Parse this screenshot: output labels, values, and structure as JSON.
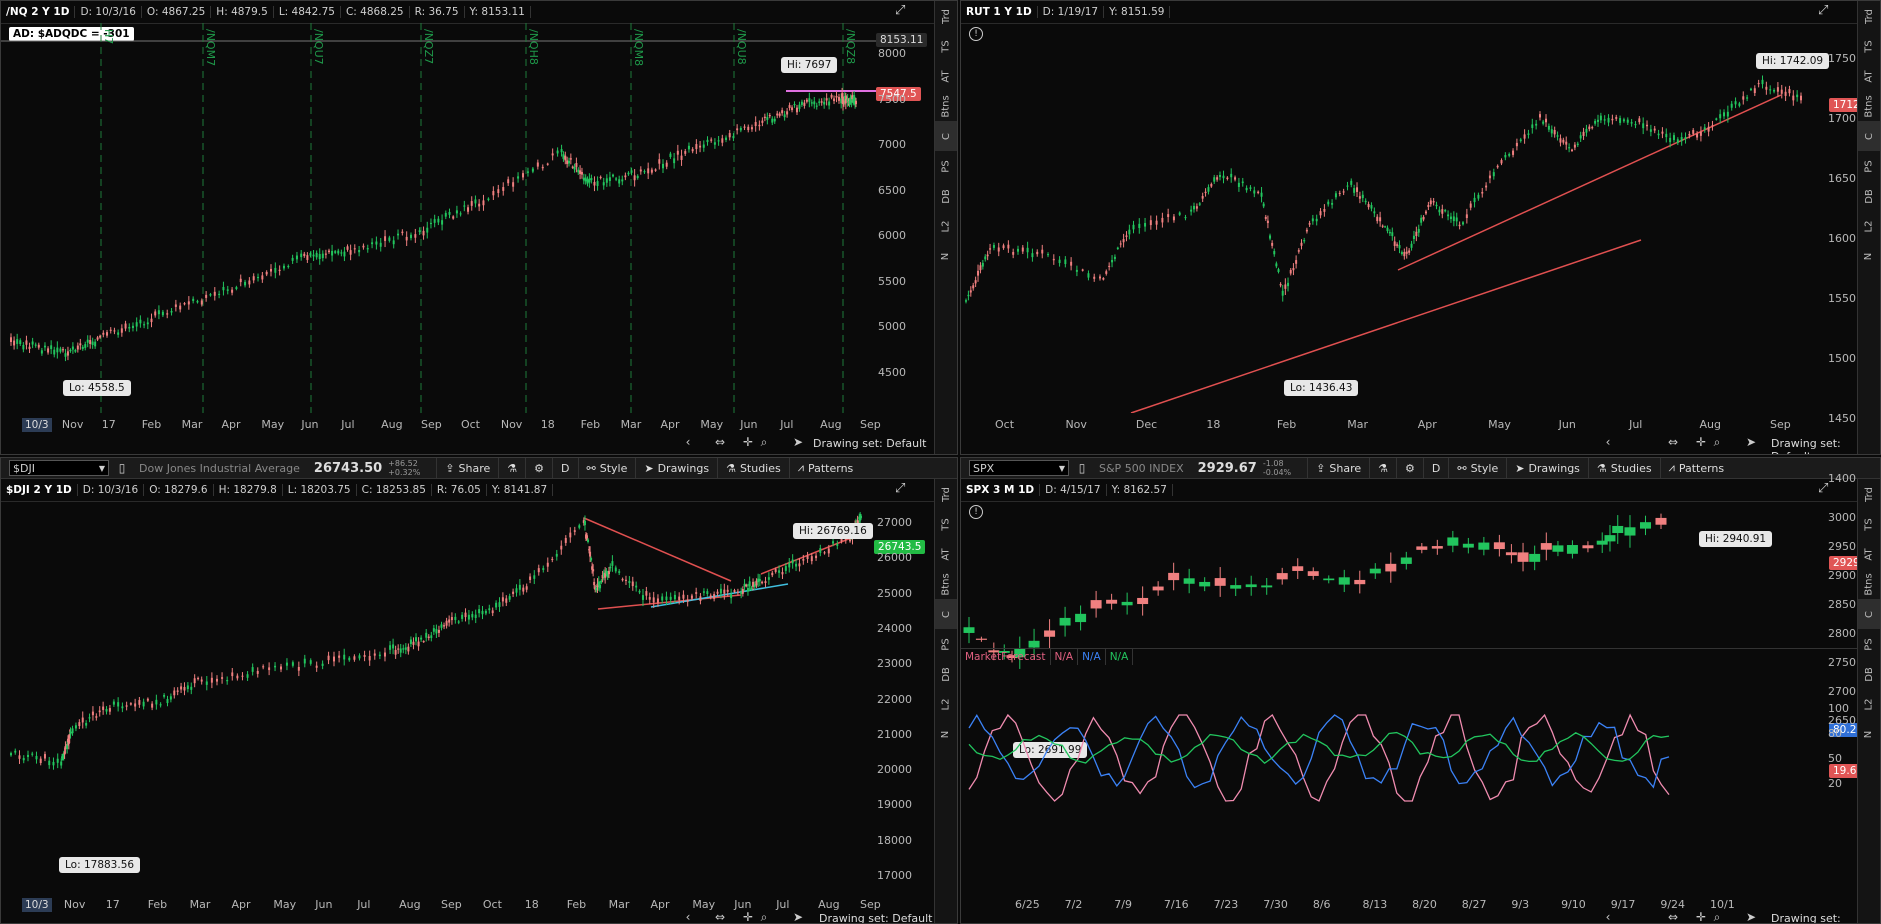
{
  "colors": {
    "up": "#22c55e",
    "down": "#f08080",
    "trend": "#e05050",
    "pink": "#e070e0",
    "cyan": "#40c0e0",
    "accent_green": "#22bb44",
    "accent_red": "#e05555",
    "accent_blue": "#2f6fd6"
  },
  "drawing_set": "Drawing set: Default",
  "side_tabs": [
    "Trd",
    "TS",
    "AT",
    "Btns",
    "C",
    "PS",
    "DB",
    "L2",
    "N"
  ],
  "p1": {
    "title": "/NQ 2 Y 1D",
    "d": "D: 10/3/16",
    "o": "O: 4867.25",
    "h": "H: 4879.5",
    "l": "L: 4842.75",
    "c": "C: 4868.25",
    "r": "R: 36.75",
    "y": "Y: 8153.11",
    "ad": "AD: $ADQDC = -301",
    "y_ticks": [
      "8000",
      "7500",
      "7000",
      "6500",
      "6000",
      "5500",
      "5000",
      "4500"
    ],
    "top_tag": "8153.11",
    "last_tag": "7547.5",
    "hi": "Hi: 7697",
    "lo": "Lo: 4558.5",
    "x_labels": [
      "10/3",
      "Nov",
      "17",
      "Feb",
      "Mar",
      "Apr",
      "May",
      "Jun",
      "Jul",
      "Aug",
      "Sep",
      "Oct",
      "Nov",
      "18",
      "Feb",
      "Mar",
      "Apr",
      "May",
      "Jun",
      "Jul",
      "Aug",
      "Sep"
    ],
    "expiries": [
      "H7",
      "/NQM7",
      "/NQU7",
      "/NQZ7",
      "/NQH8",
      "/NQM8",
      "/NQU8",
      "/NQZ8"
    ]
  },
  "p2": {
    "title": "RUT 1 Y 1D",
    "d": "D: 1/19/17",
    "y": "Y: 8151.59",
    "y_ticks": [
      "1750",
      "1700",
      "1650",
      "1600",
      "1550",
      "1500",
      "1450",
      "1400"
    ],
    "last_tag": "1712.32",
    "hi": "Hi: 1742.09",
    "lo": "Lo: 1436.43",
    "x_labels": [
      "Oct",
      "Nov",
      "Dec",
      "18",
      "Feb",
      "Mar",
      "Apr",
      "May",
      "Jun",
      "Jul",
      "Aug",
      "Sep"
    ]
  },
  "p3": {
    "symbol": "$DJI",
    "name": "Dow Jones Industrial Average",
    "price": "26743.50",
    "chg": "+86.52",
    "pct": "+0.32%",
    "title": "$DJI 2 Y 1D",
    "d": "D: 10/3/16",
    "o": "O: 18279.6",
    "h": "H: 18279.8",
    "l": "L: 18203.75",
    "c": "C: 18253.85",
    "r": "R: 76.05",
    "y": "Y: 8141.87",
    "y_ticks": [
      "27000",
      "26000",
      "25000",
      "24000",
      "23000",
      "22000",
      "21000",
      "20000",
      "19000",
      "18000",
      "17000"
    ],
    "last_tag": "26743.5",
    "hi": "Hi: 26769.16",
    "lo": "Lo: 17883.56",
    "x_labels": [
      "10/3",
      "Nov",
      "17",
      "Feb",
      "Mar",
      "Apr",
      "May",
      "Jun",
      "Jul",
      "Aug",
      "Sep",
      "Oct",
      "18",
      "Feb",
      "Mar",
      "Apr",
      "May",
      "Jun",
      "Jul",
      "Aug",
      "Sep"
    ]
  },
  "p4": {
    "symbol": "SPX",
    "name": "S&P 500 INDEX",
    "price": "2929.67",
    "chg": "-1.08",
    "pct": "-0.04%",
    "title": "SPX 3 M 1D",
    "d": "D: 4/15/17",
    "y": "Y: 8162.57",
    "y_ticks": [
      "3000",
      "2950",
      "2900",
      "2850",
      "2800",
      "2750",
      "2700",
      "2650"
    ],
    "last_tag": "2929.67",
    "hi": "Hi: 2940.91",
    "lo": "Lo: 2691.99",
    "study": "MarketForecast",
    "na1": "N/A",
    "na2": "N/A",
    "na3": "N/A",
    "osc_ticks": [
      "100",
      "80",
      "50",
      "20"
    ],
    "osc_tag1": "80.2838",
    "osc_tag2": "19.691",
    "x_labels": [
      "6/25",
      "7/2",
      "7/9",
      "7/16",
      "7/23",
      "7/30",
      "8/6",
      "8/13",
      "8/20",
      "8/27",
      "9/3",
      "9/10",
      "9/17",
      "9/24",
      "10/1"
    ]
  },
  "toolbar": {
    "share": "Share",
    "style": "Style",
    "drawings": "Drawings",
    "studies": "Studies",
    "patterns": "Patterns",
    "agg": "D"
  }
}
